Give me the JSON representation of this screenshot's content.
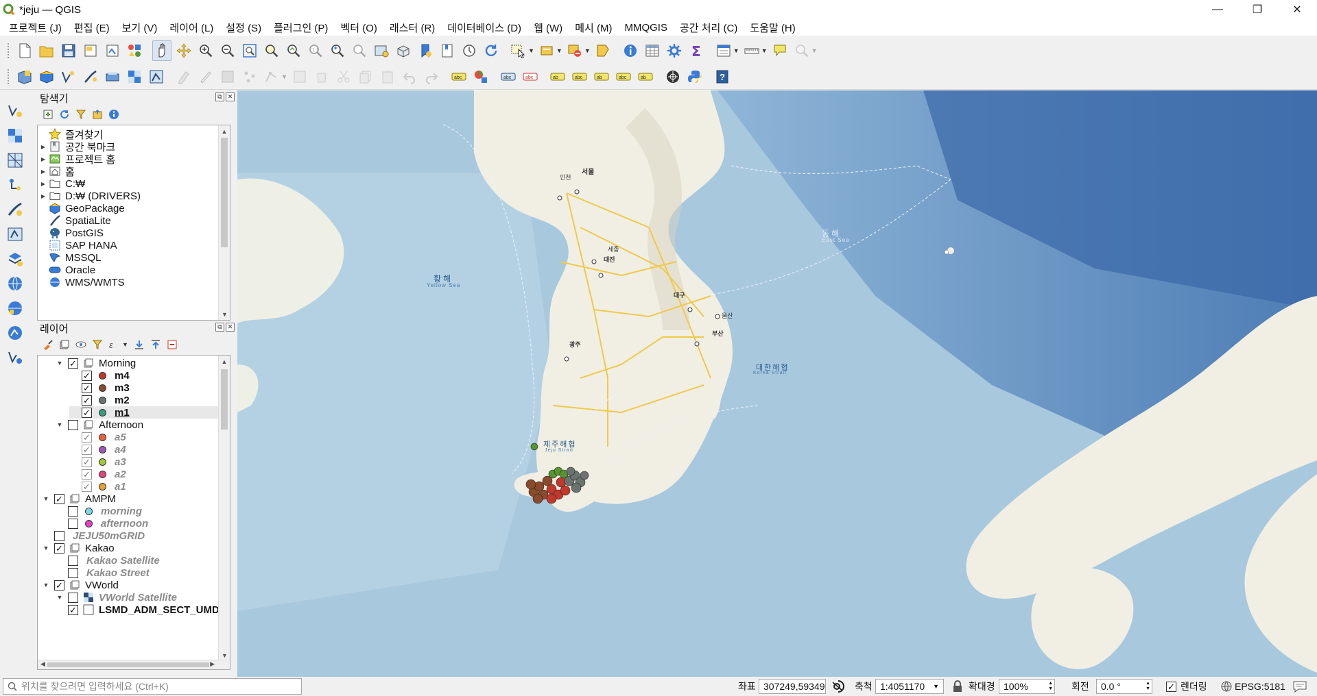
{
  "window": {
    "title": "*jeju — QGIS",
    "minimize": "—",
    "maximize": "❐",
    "close": "✕"
  },
  "menu": [
    "프로젝트 (J)",
    "편집 (E)",
    "보기 (V)",
    "레이어 (L)",
    "설정 (S)",
    "플러그인 (P)",
    "벡터 (O)",
    "래스터 (R)",
    "데이터베이스 (D)",
    "웹 (W)",
    "메시 (M)",
    "MMQGIS",
    "공간 처리 (C)",
    "도움말 (H)"
  ],
  "browser": {
    "title": "탐색기",
    "items": [
      {
        "label": "즐겨찾기",
        "icon": "star-icon",
        "arrow": false
      },
      {
        "label": "공간 북마크",
        "icon": "bookmark-icon",
        "arrow": true
      },
      {
        "label": "프로젝트 홈",
        "icon": "project-home-icon",
        "arrow": true
      },
      {
        "label": "홈",
        "icon": "home-icon",
        "arrow": true
      },
      {
        "label": "C:₩",
        "icon": "folder-icon",
        "arrow": true
      },
      {
        "label": "D:₩ (DRIVERS)",
        "icon": "folder-icon",
        "arrow": true
      },
      {
        "label": "GeoPackage",
        "icon": "geopackage-icon",
        "arrow": false
      },
      {
        "label": "SpatiaLite",
        "icon": "spatialite-icon",
        "arrow": false
      },
      {
        "label": "PostGIS",
        "icon": "postgis-icon",
        "arrow": false
      },
      {
        "label": "SAP HANA",
        "icon": "sap-hana-icon",
        "arrow": false
      },
      {
        "label": "MSSQL",
        "icon": "mssql-icon",
        "arrow": false
      },
      {
        "label": "Oracle",
        "icon": "oracle-icon",
        "arrow": false
      },
      {
        "label": "WMS/WMTS",
        "icon": "wms-icon",
        "arrow": false
      }
    ]
  },
  "layers": {
    "title": "레이어",
    "items": [
      {
        "label": "Morning",
        "indent": 1,
        "type": "group",
        "checked": true,
        "expanded": true
      },
      {
        "label": "m4",
        "indent": 2,
        "type": "point",
        "checked": true,
        "color": "#c0392b",
        "style": "bold"
      },
      {
        "label": "m3",
        "indent": 2,
        "type": "point",
        "checked": true,
        "color": "#8b4a2b",
        "style": "bold"
      },
      {
        "label": "m2",
        "indent": 2,
        "type": "point",
        "checked": true,
        "color": "#6b7370",
        "style": "bold"
      },
      {
        "label": "m1",
        "indent": 2,
        "type": "point",
        "checked": true,
        "color": "#3f9a7f",
        "style": "bold-underline"
      },
      {
        "label": "Afternoon",
        "indent": 1,
        "type": "group",
        "checked": false,
        "expanded": true
      },
      {
        "label": "a5",
        "indent": 2,
        "type": "point",
        "checked": true,
        "dim": true,
        "color": "#e8623c",
        "style": "italic"
      },
      {
        "label": "a4",
        "indent": 2,
        "type": "point",
        "checked": true,
        "dim": true,
        "color": "#9b59b6",
        "style": "italic"
      },
      {
        "label": "a3",
        "indent": 2,
        "type": "point",
        "checked": true,
        "dim": true,
        "color": "#a4c93a",
        "style": "italic"
      },
      {
        "label": "a2",
        "indent": 2,
        "type": "point",
        "checked": true,
        "dim": true,
        "color": "#e2457a",
        "style": "italic"
      },
      {
        "label": "a1",
        "indent": 2,
        "type": "point",
        "checked": true,
        "dim": true,
        "color": "#e6a23c",
        "style": "italic"
      },
      {
        "label": "AMPM",
        "indent": 0,
        "type": "group",
        "checked": true,
        "expanded": true
      },
      {
        "label": "morning",
        "indent": 1,
        "type": "point",
        "checked": false,
        "color": "#7fd8e8",
        "style": "italic"
      },
      {
        "label": "afternoon",
        "indent": 1,
        "type": "point",
        "checked": false,
        "color": "#e83fc8",
        "style": "italic"
      },
      {
        "label": "JEJU50mGRID",
        "indent": 0,
        "type": "grid",
        "checked": false,
        "style": "italic"
      },
      {
        "label": "Kakao",
        "indent": 0,
        "type": "group",
        "checked": true,
        "expanded": true
      },
      {
        "label": "Kakao Satellite",
        "indent": 1,
        "type": "raster",
        "checked": false,
        "style": "italic"
      },
      {
        "label": "Kakao Street",
        "indent": 1,
        "type": "raster",
        "checked": false,
        "style": "italic"
      },
      {
        "label": "VWorld",
        "indent": 0,
        "type": "group",
        "checked": true,
        "expanded": true
      },
      {
        "label": "VWorld Satellite",
        "indent": 1,
        "type": "raster-tile",
        "checked": false,
        "style": "italic",
        "arrow": true
      },
      {
        "label": "LSMD_ADM_SECT_UMD",
        "indent": 1,
        "type": "polygon",
        "checked": true,
        "style": "bold"
      }
    ]
  },
  "map": {
    "labels": {
      "yellow_sea_kr": "황해",
      "yellow_sea_en": "Yellow Sea",
      "east_sea_kr": "동해",
      "east_sea_en": "East Sea",
      "korea_strait_kr": "대한해협",
      "korea_strait_en": "Korea Strait",
      "jeju_strait_kr": "제주해협",
      "jeju_strait_en": "Jeju Strait",
      "seoul": "서울",
      "incheon": "인천",
      "daejeon": "대전",
      "daegu": "대구",
      "gwangju": "광주",
      "busan": "부산",
      "sejong": "세종",
      "ulsan": "울산"
    }
  },
  "status": {
    "locator_placeholder": "위치를 찾으려면 입력하세요 (Ctrl+K)",
    "coord_label": "좌표",
    "coord_value": "307249,59349",
    "scale_label": "축척",
    "scale_value": "1:4051170",
    "magnifier_label": "확대경",
    "magnifier_value": "100%",
    "rotation_label": "회전",
    "rotation_value": "0.0 °",
    "render_label": "렌더링",
    "render_checked": "✓",
    "crs": "EPSG:5181"
  }
}
